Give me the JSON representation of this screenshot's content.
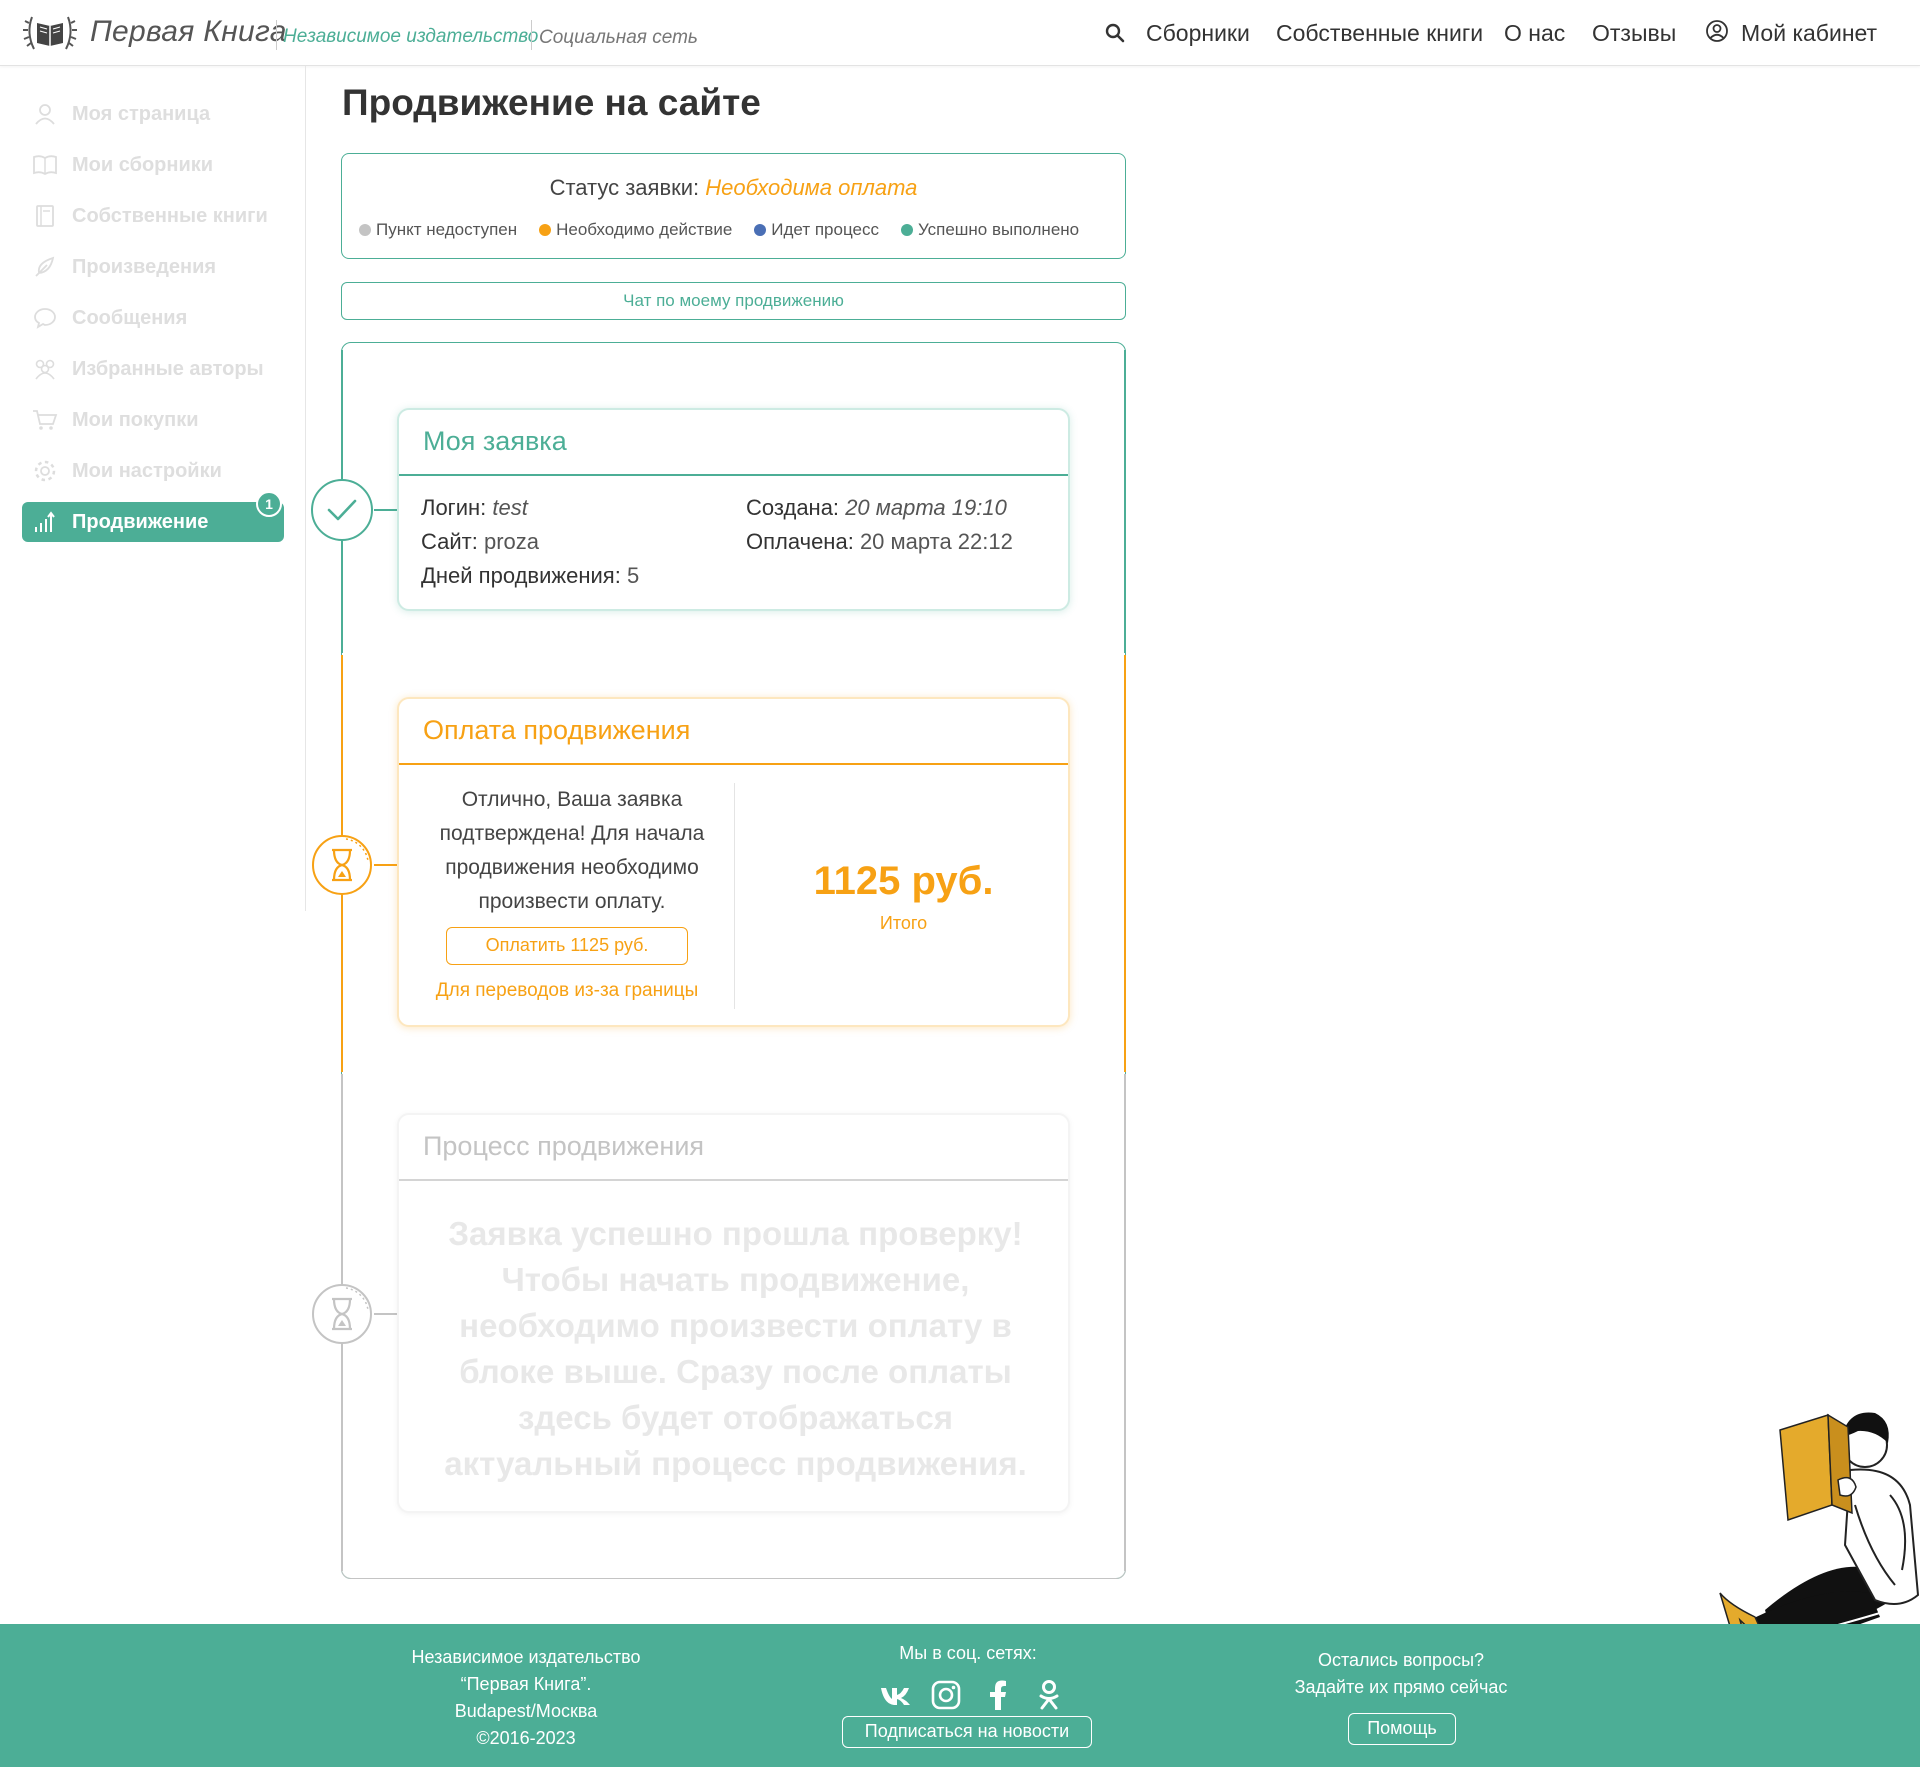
{
  "header": {
    "brand_name": "Первая Книга",
    "brand_tagline": "Независимое издательство",
    "brand_social": "Социальная сеть",
    "nav": [
      "Сборники",
      "Собственные книги",
      "О нас",
      "Отзывы"
    ],
    "cabinet": "Мой кабинет"
  },
  "sidebar": {
    "items": [
      {
        "label": "Моя страница",
        "icon": "user-icon"
      },
      {
        "label": "Мои сборники",
        "icon": "book-open-icon"
      },
      {
        "label": "Собственные книги",
        "icon": "book-icon"
      },
      {
        "label": "Произведения",
        "icon": "feather-icon"
      },
      {
        "label": "Сообщения",
        "icon": "chat-icon"
      },
      {
        "label": "Избранные авторы",
        "icon": "people-icon"
      },
      {
        "label": "Мои покупки",
        "icon": "cart-icon"
      },
      {
        "label": "Мои настройки",
        "icon": "gear-icon"
      },
      {
        "label": "Продвижение",
        "icon": "chart-up-icon",
        "active": true
      }
    ],
    "badge": "1"
  },
  "main": {
    "title": "Продвижение на сайте",
    "status": {
      "label": "Статус заявки:",
      "value": "Необходима оплата",
      "value_color": "#f7a114"
    },
    "legend": [
      {
        "label": "Пункт недоступен",
        "color": "#c4c4c4"
      },
      {
        "label": "Необходимо действие",
        "color": "#f7a114"
      },
      {
        "label": "Идет процесс",
        "color": "#4a6fb5"
      },
      {
        "label": "Успешно выполнено",
        "color": "#4cae96"
      }
    ],
    "chat_button": "Чат по моему продвижению",
    "request": {
      "title": "Моя заявка",
      "login_label": "Логин:",
      "login_value": "test",
      "site_label": "Сайт:",
      "site_value": "proza",
      "days_label": "Дней продвижения:",
      "days_value": "5",
      "created_label": "Создана:",
      "created_value": "20 марта 19:10",
      "paid_label": "Оплачена:",
      "paid_value": "20 марта 22:12"
    },
    "payment": {
      "title": "Оплата продвижения",
      "text": "Отлично, Ваша заявка подтверждена! Для начала продвижения необходимо произвести оплату.",
      "button": "Оплатить 1125 руб.",
      "abroad_link": "Для переводов из-за границы",
      "amount": "1125 руб.",
      "amount_label": "Итого"
    },
    "process": {
      "title": "Процесс продвижения",
      "text": "Заявка успешно прошла проверку! Чтобы начать продвижение, необходимо произвести оплату в блоке выше. Сразу после оплаты здесь будет отображаться актуальный процесс продвижения."
    }
  },
  "footer": {
    "about_line1": "Независимое издательство",
    "about_line2": "“Первая Книга”.",
    "about_line3": "Budapest/Москва",
    "about_line4": "©2016-2023",
    "social_title": "Мы в соц. сетях:",
    "social_icons": [
      "vk-icon",
      "instagram-icon",
      "facebook-icon",
      "odnoklassniki-icon"
    ],
    "subscribe": "Подписаться на новости",
    "questions_line1": "Остались вопросы?",
    "questions_line2": "Задайте их прямо сейчас",
    "help": "Помощь"
  },
  "colors": {
    "accent": "#4cae96",
    "warning": "#f7a114",
    "inactive": "#c4c4c4"
  }
}
